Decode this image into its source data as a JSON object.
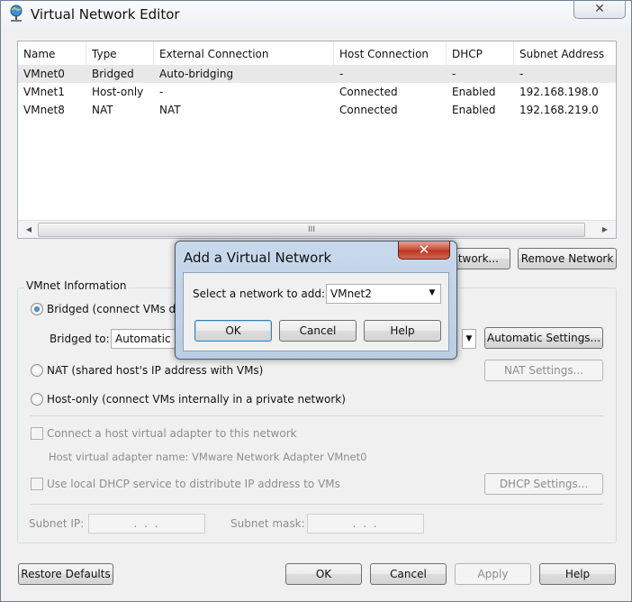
{
  "window": {
    "title": "Virtual Network Editor",
    "close_glyph": "✕"
  },
  "table": {
    "columns": [
      "Name",
      "Type",
      "External Connection",
      "Host Connection",
      "DHCP",
      "Subnet Address"
    ],
    "rows": [
      [
        "VMnet0",
        "Bridged",
        "Auto-bridging",
        "-",
        "-",
        "-"
      ],
      [
        "VMnet1",
        "Host-only",
        "-",
        "Connected",
        "Enabled",
        "192.168.198.0"
      ],
      [
        "VMnet8",
        "NAT",
        "NAT",
        "Connected",
        "Enabled",
        "192.168.219.0"
      ]
    ],
    "scroll_grip": "III"
  },
  "network_buttons": {
    "add_partial": "twork...",
    "remove": "Remove Network"
  },
  "vmnet_info": {
    "legend": "VMnet Information",
    "bridged_label": "Bridged (connect VMs dir",
    "bridged_to_label": "Bridged to:",
    "bridged_to_value": "Automatic",
    "automatic_settings": "Automatic Settings...",
    "nat_label": "NAT (shared host's IP address with VMs)",
    "nat_settings": "NAT Settings...",
    "hostonly_label": "Host-only (connect VMs internally in a private network)",
    "connect_adapter_label": "Connect a host virtual adapter to this network",
    "adapter_name_label": "Host virtual adapter name: VMware Network Adapter VMnet0",
    "dhcp_label": "Use local DHCP service to distribute IP address to VMs",
    "dhcp_settings": "DHCP Settings...",
    "subnet_ip_label": "Subnet IP:",
    "subnet_ip_value": ". . .",
    "subnet_mask_label": "Subnet mask:",
    "subnet_mask_value": ". . ."
  },
  "footer": {
    "restore_defaults": "Restore Defaults",
    "ok": "OK",
    "cancel": "Cancel",
    "apply": "Apply",
    "help": "Help"
  },
  "dialog": {
    "title": "Add a Virtual Network",
    "close_glyph": "✕",
    "select_label": "Select a network to add:",
    "select_value": "VMnet2",
    "ok": "OK",
    "cancel": "Cancel",
    "help": "Help"
  },
  "colors": {
    "selected_row": "#e8e8e8",
    "dialog_frame": "#c8d9ec",
    "close_red": "#c74a33"
  },
  "icons": {
    "app": "network-globe-icon",
    "dropdown": "chevron-down-icon"
  }
}
